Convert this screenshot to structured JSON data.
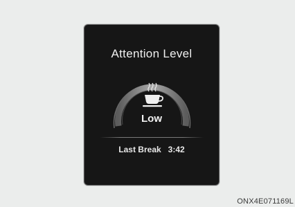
{
  "display": {
    "title": "Attention Level",
    "level_label": "Low",
    "last_break_label": "Last Break",
    "last_break_time": "3:42",
    "gauge_icon": "coffee-cup-icon"
  },
  "figure_code": "ONX4E071169L",
  "colors": {
    "panel_background": "#161616",
    "text": "#f0f0f0",
    "gauge_track": "#3a3a3a",
    "gauge_fill": "#8f8f8f"
  }
}
